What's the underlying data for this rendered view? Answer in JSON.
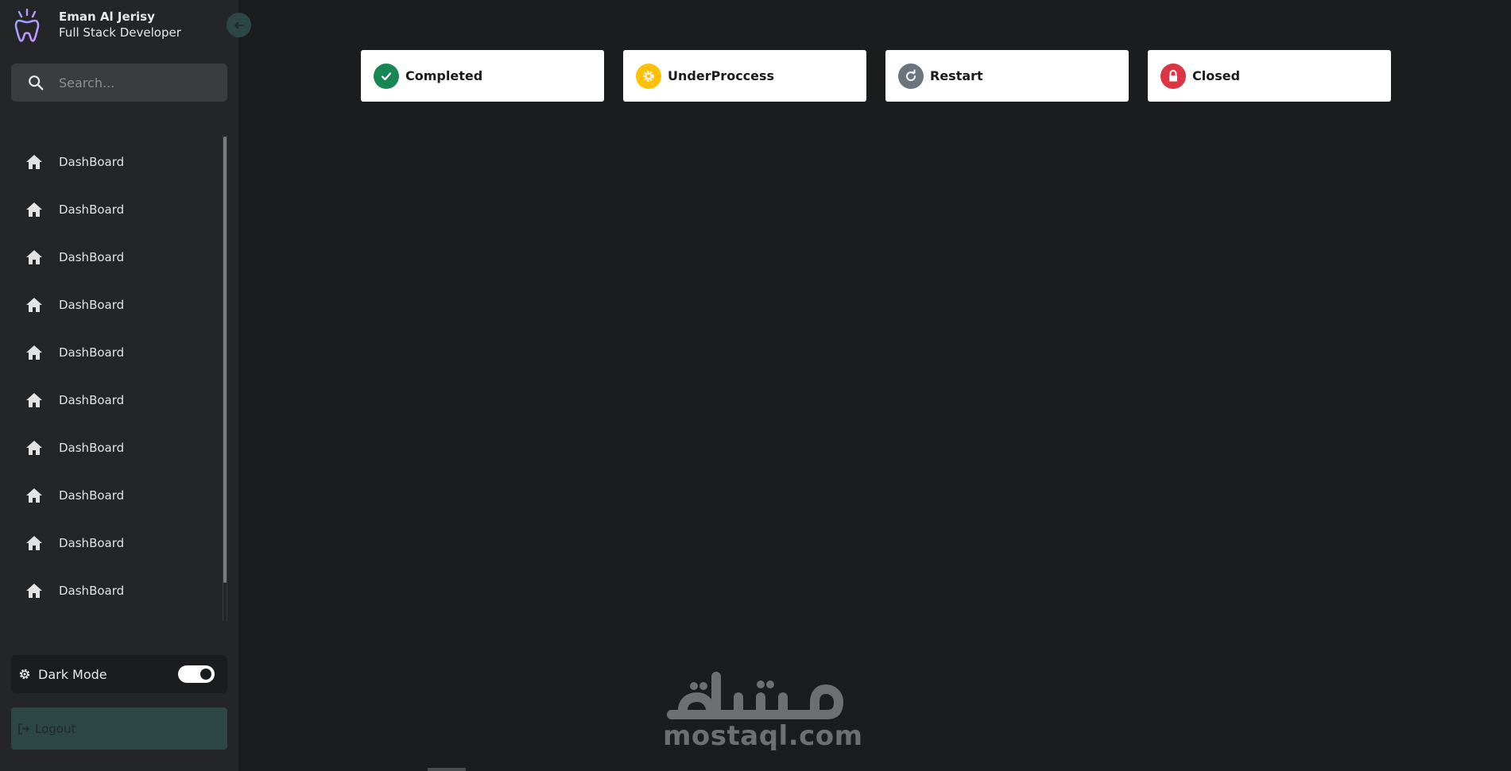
{
  "profile": {
    "name": "Eman Al Jerisy",
    "role": "Full Stack Developer"
  },
  "search": {
    "placeholder": "Search...",
    "value": ""
  },
  "sidebar": {
    "items": [
      {
        "label": "DashBoard",
        "icon": "home-icon"
      },
      {
        "label": "DashBoard",
        "icon": "home-icon"
      },
      {
        "label": "DashBoard",
        "icon": "home-icon"
      },
      {
        "label": "DashBoard",
        "icon": "home-icon"
      },
      {
        "label": "DashBoard",
        "icon": "home-icon"
      },
      {
        "label": "DashBoard",
        "icon": "home-icon"
      },
      {
        "label": "DashBoard",
        "icon": "home-icon"
      },
      {
        "label": "DashBoard",
        "icon": "home-icon"
      },
      {
        "label": "DashBoard",
        "icon": "home-icon"
      },
      {
        "label": "DashBoard",
        "icon": "home-icon"
      }
    ],
    "dark_mode_label": "Dark Mode",
    "dark_mode_on": true,
    "logout_label": "Logout"
  },
  "status_cards": [
    {
      "label": "Completed",
      "icon": "check-icon",
      "color": "#198754"
    },
    {
      "label": "UnderProccess",
      "icon": "cog-icon",
      "color": "#ffc107"
    },
    {
      "label": "Restart",
      "icon": "refresh-icon",
      "color": "#6c757d"
    },
    {
      "label": "Closed",
      "icon": "lock-icon",
      "color": "#dc3545"
    }
  ],
  "watermark": {
    "text": "mostaql.com"
  },
  "colors": {
    "background": "#1b1c1e",
    "sidebar": "#242527",
    "accent": "#2c4745"
  }
}
